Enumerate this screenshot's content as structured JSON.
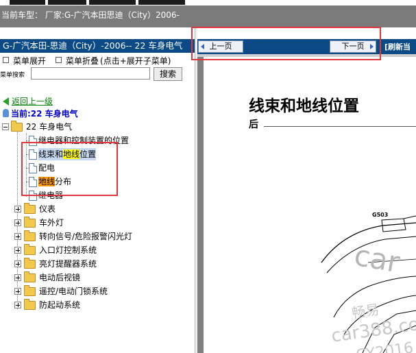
{
  "window": {
    "vehicle_info": "当前车型：  厂家:G-广汽本田思迪（City）2006-"
  },
  "left_panel": {
    "title": "G-广汽本田-思迪（City）-2006-- 22 车身电气",
    "menu_expand": "菜单展开",
    "menu_collapse": "菜单折叠",
    "menu_hint": "(点击+展开子菜单)",
    "search_label": "菜单搜索",
    "search_value": "",
    "search_button": "搜索",
    "back_link": "返回上一级",
    "current_label": "当前:22 车身电气",
    "tree_root": "22 车身电气",
    "doc_items": [
      {
        "pre": "继电器和控制装置的位置",
        "hl": "",
        "post": ""
      },
      {
        "pre": "线束和",
        "hl": "地线",
        "post": "位置"
      },
      {
        "pre": "配电",
        "hl": "",
        "post": ""
      },
      {
        "pre": "",
        "hl": "地线",
        "post": "分布"
      },
      {
        "pre": "继电器",
        "hl": "",
        "post": ""
      }
    ],
    "folder_items": [
      "仪表",
      "车外灯",
      "转向信号/危险报警闪光灯",
      "入口灯控制系统",
      "亮灯提醒器系统",
      "电动后视镜",
      "遥控/电动门锁系统",
      "防起动系统"
    ]
  },
  "right_panel": {
    "prev_button": "上一页",
    "next_button": "下一页",
    "refresh": "[刷新当",
    "doc_title": "线束和地线位置",
    "doc_subtitle": "后",
    "diagram_label": "G503",
    "watermarks": [
      "car",
      "畅易",
      "car388.co",
      "CY2016"
    ]
  },
  "colors": {
    "title_bar": "#0b4a85",
    "highlight_yellow": "#ffff00",
    "highlight_orange": "#ff9900",
    "annotation_red": "#e0353c"
  }
}
